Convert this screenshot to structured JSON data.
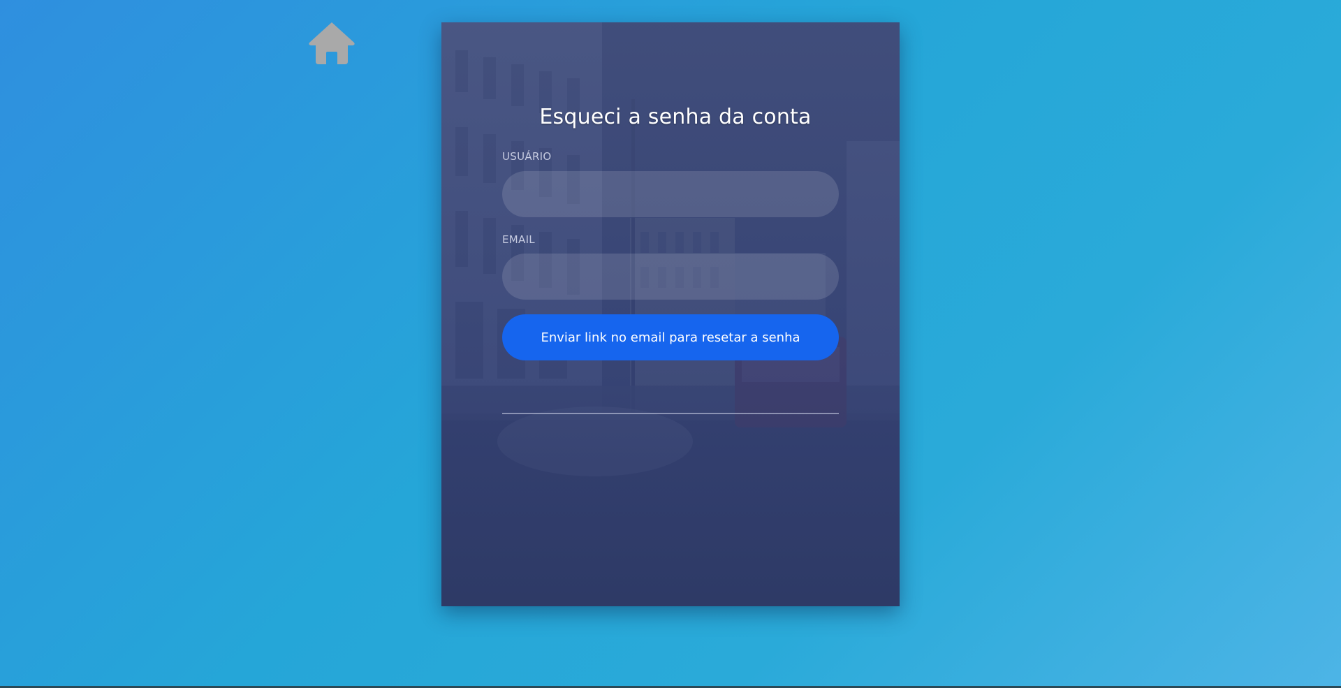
{
  "home": {
    "icon": "home-icon",
    "icon_color": "#a9a9a9"
  },
  "card": {
    "title": "Esqueci a senha da conta",
    "background_image": "city-street-bus-photo"
  },
  "form": {
    "user_label": "USUÁRIO",
    "user_value": "",
    "email_label": "EMAIL",
    "email_value": "",
    "submit_label": "Enviar link no email para resetar a senha"
  },
  "colors": {
    "page_gradient_start": "#2f8fdf",
    "page_gradient_end": "#4db4e6",
    "card_overlay": "#3e4a78",
    "button": "#1665ee"
  }
}
